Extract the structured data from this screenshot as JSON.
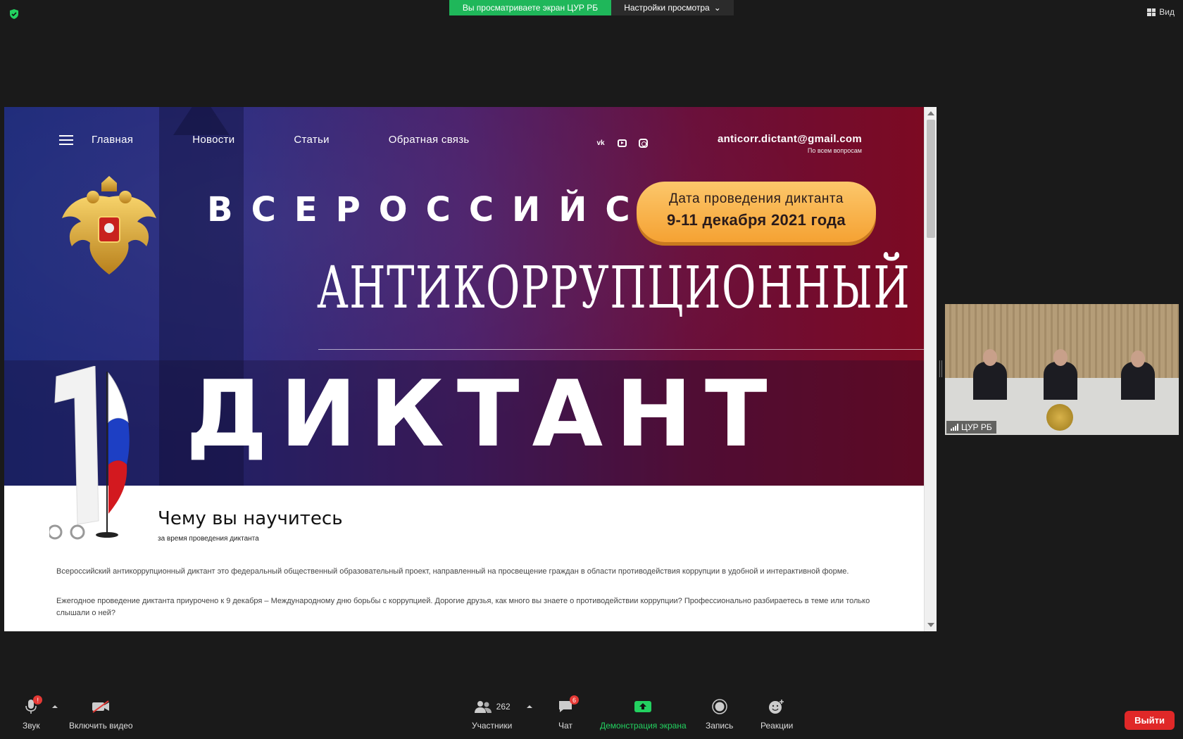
{
  "topbar": {
    "viewing_text": "Вы просматриваете экран ЦУР РБ",
    "view_settings": "Настройки просмотра",
    "view_label": "Вид"
  },
  "site": {
    "nav": [
      "Главная",
      "Новости",
      "Статьи",
      "Обратная связь"
    ],
    "socials": [
      "vk-icon",
      "youtube-icon",
      "instagram-icon"
    ],
    "email": "anticorr.dictant@gmail.com",
    "email_sub": "По всем вопросам",
    "title_line1": "ВСЕРОССИЙСКИЙ",
    "title_line2": "АНТИКОРРУПЦИОННЫЙ",
    "title_line3": "ДИКТАНТ",
    "date_label": "Дата проведения диктанта",
    "date_value": "9-11 декабря 2021 года",
    "section_title": "Чему вы научитесь",
    "section_sub": "за время проведения диктанта",
    "p1": "Всероссийский антикоррупционный диктант это федеральный общественный образовательный проект, направленный на просвещение граждан в области противодействия коррупции в удобной и интерактивной форме.",
    "p2": "Ежегодное проведение диктанта приурочено к 9 декабря – Международному дню борьбы с коррупцией. Дорогие друзья, как много вы знаете о противодействии коррупции? Профессионально разбираетесь в теме или только слышали о ней?"
  },
  "video": {
    "name": "ЦУР РБ"
  },
  "toolbar": {
    "audio": "Звук",
    "video": "Включить видео",
    "participants": "Участники",
    "participants_count": "262",
    "chat": "Чат",
    "chat_badge": "6",
    "share": "Демонстрация экрана",
    "record": "Запись",
    "reactions": "Реакции",
    "leave": "Выйти",
    "audio_badge": "!"
  },
  "colors": {
    "share_green": "#23d160",
    "leave_red": "#e02828",
    "date_pill": "#f5a233"
  }
}
